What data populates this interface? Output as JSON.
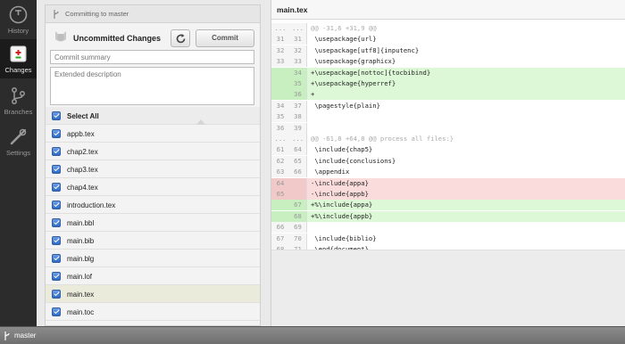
{
  "nav": {
    "items": [
      {
        "label": "History",
        "icon": "history-icon"
      },
      {
        "label": "Changes",
        "icon": "changes-icon"
      },
      {
        "label": "Branches",
        "icon": "branches-icon"
      },
      {
        "label": "Settings",
        "icon": "settings-icon"
      }
    ],
    "active": "Changes"
  },
  "commit_panel": {
    "branch_status": "Committing to master",
    "title": "Uncommitted Changes",
    "commit_label": "Commit",
    "summary_placeholder": "Commit summary",
    "description_placeholder": "Extended description",
    "select_all_label": "Select All",
    "files": [
      "appb.tex",
      "chap2.tex",
      "chap3.tex",
      "chap4.tex",
      "introduction.tex",
      "main.bbl",
      "main.bib",
      "main.blg",
      "main.lof",
      "main.tex",
      "main.toc"
    ],
    "selected_file": "main.tex"
  },
  "diff": {
    "filename": "main.tex",
    "lines": [
      {
        "type": "hunk",
        "old": "...",
        "new": "...",
        "text": "@@ -31,6 +31,9 @@"
      },
      {
        "type": "ctx",
        "old": "31",
        "new": "31",
        "text": " \\usepackage{url}"
      },
      {
        "type": "ctx",
        "old": "32",
        "new": "32",
        "text": " \\usepackage[utf8]{inputenc}"
      },
      {
        "type": "ctx",
        "old": "33",
        "new": "33",
        "text": " \\usepackage{graphicx}"
      },
      {
        "type": "add",
        "old": "",
        "new": "34",
        "text": "+\\usepackage[nottoc]{tocbibind}"
      },
      {
        "type": "add",
        "old": "",
        "new": "35",
        "text": "+\\usepackage{hyperref}"
      },
      {
        "type": "add",
        "old": "",
        "new": "36",
        "text": "+"
      },
      {
        "type": "ctx",
        "old": "34",
        "new": "37",
        "text": " \\pagestyle{plain}"
      },
      {
        "type": "ctx",
        "old": "35",
        "new": "38",
        "text": ""
      },
      {
        "type": "ctx",
        "old": "36",
        "new": "39",
        "text": ""
      },
      {
        "type": "hunk",
        "old": "...",
        "new": "...",
        "text": "@@ -61,8 +64,8 @@ process all files:}"
      },
      {
        "type": "ctx",
        "old": "61",
        "new": "64",
        "text": " \\include{chap5}"
      },
      {
        "type": "ctx",
        "old": "62",
        "new": "65",
        "text": " \\include{conclusions}"
      },
      {
        "type": "ctx",
        "old": "63",
        "new": "66",
        "text": " \\appendix"
      },
      {
        "type": "del",
        "old": "64",
        "new": "",
        "text": "-\\include{appa}"
      },
      {
        "type": "del",
        "old": "65",
        "new": "",
        "text": "-\\include{appb}"
      },
      {
        "type": "add",
        "old": "",
        "new": "67",
        "text": "+%\\include{appa}"
      },
      {
        "type": "add",
        "old": "",
        "new": "68",
        "text": "+%\\include{appb}"
      },
      {
        "type": "ctx",
        "old": "66",
        "new": "69",
        "text": ""
      },
      {
        "type": "ctx",
        "old": "67",
        "new": "70",
        "text": " \\include{biblio}"
      },
      {
        "type": "ctx",
        "old": "68",
        "new": "71",
        "text": " \\end{document}"
      }
    ]
  },
  "status_bar": {
    "branch": "master"
  },
  "colors": {
    "added": "#dcf8d6",
    "removed": "#fadcdc",
    "checkbox": "#2f6ac4",
    "rail": "#2c2c2c"
  }
}
